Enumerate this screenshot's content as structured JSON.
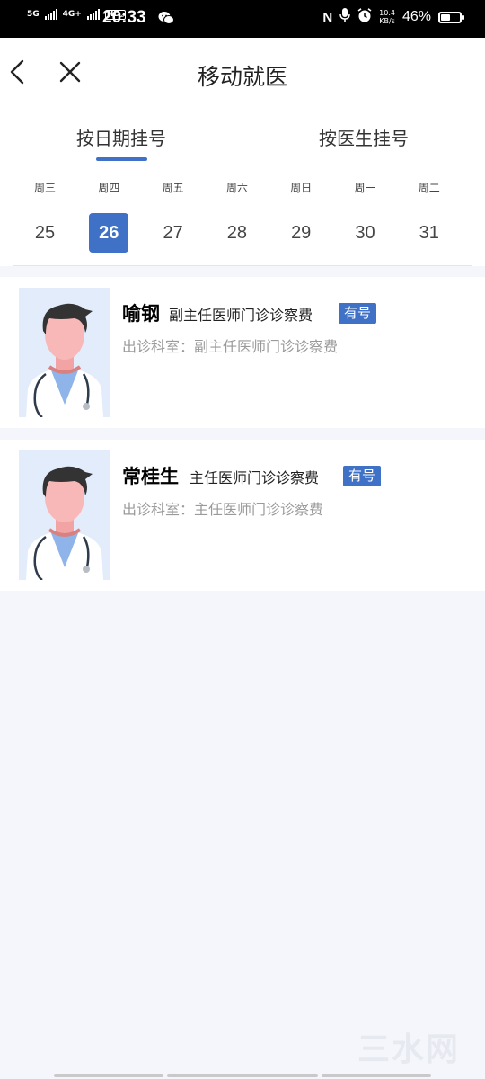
{
  "status_bar": {
    "network_1": "5G",
    "network_2": "4G+",
    "hd": "HD",
    "hd_sub": "2",
    "time": "20:33",
    "nfc": "N",
    "net_speed_value": "10.4",
    "net_speed_unit": "KB/s",
    "battery_percent": "46%",
    "battery_level": 0.46
  },
  "nav": {
    "title": "移动就医"
  },
  "tabs": [
    {
      "label": "按日期挂号",
      "active": true
    },
    {
      "label": "按医生挂号",
      "active": false
    }
  ],
  "dates": [
    {
      "weekday": "周三",
      "day": "25"
    },
    {
      "weekday": "周四",
      "day": "26",
      "selected": true
    },
    {
      "weekday": "周五",
      "day": "27"
    },
    {
      "weekday": "周六",
      "day": "28"
    },
    {
      "weekday": "周日",
      "day": "29"
    },
    {
      "weekday": "周一",
      "day": "30"
    },
    {
      "weekday": "周二",
      "day": "31"
    }
  ],
  "doctors": [
    {
      "name": "喻钢",
      "title": "副主任医师门诊诊察费",
      "badge": "有号",
      "dept_label": "出诊科室：",
      "dept": "副主任医师门诊诊察费"
    },
    {
      "name": "常桂生",
      "title": "主任医师门诊诊察费",
      "badge": "有号",
      "dept_label": "出诊科室：",
      "dept": "主任医师门诊诊察费"
    }
  ],
  "colors": {
    "accent": "#3f72c6",
    "page_bg": "#f4f6fb",
    "avatar_bg": "#e2ecfa"
  },
  "icons": {
    "back": "chevron-left-icon",
    "close": "close-icon",
    "wechat": "wechat-icon",
    "mic": "microphone-icon",
    "alarm": "alarm-icon",
    "doctor": "doctor-avatar"
  }
}
